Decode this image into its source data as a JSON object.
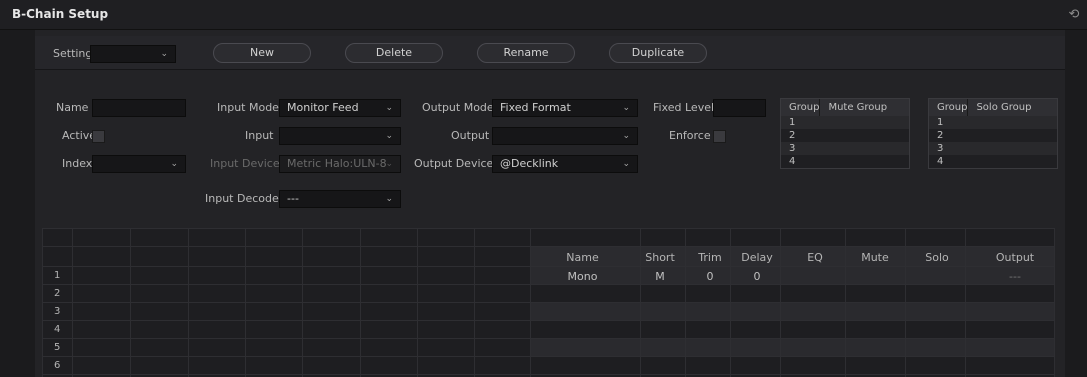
{
  "title": "B-Chain Setup",
  "toolbar": {
    "setting_label": "Setting",
    "setting_value": "",
    "buttons": [
      "New",
      "Delete",
      "Rename",
      "Duplicate"
    ]
  },
  "form": {
    "name_label": "Name",
    "active_label": "Active",
    "index_label": "Index",
    "input_mode_label": "Input Mode",
    "input_mode_value": "Monitor Feed",
    "input_label": "Input",
    "input_value": "",
    "input_device_label": "Input Device",
    "input_device_value": "Metric Halo:ULN-8",
    "input_decoder_label": "Input Decoder",
    "input_decoder_value": "---",
    "output_mode_label": "Output Mode",
    "output_mode_value": "Fixed Format",
    "output_label": "Output",
    "output_value": "",
    "output_device_label": "Output Device",
    "output_device_value": "@Decklink",
    "fixed_level_label": "Fixed Level",
    "enforce_label": "Enforce"
  },
  "mute_table": {
    "headers": [
      "Group",
      "Mute Group"
    ],
    "rows": [
      "1",
      "2",
      "3",
      "4"
    ]
  },
  "solo_table": {
    "headers": [
      "Group",
      "Solo Group"
    ],
    "rows": [
      "1",
      "2",
      "3",
      "4"
    ]
  },
  "channels": {
    "row_numbers": [
      "1",
      "2",
      "3",
      "4",
      "5",
      "6"
    ],
    "headers": [
      "Name",
      "Short",
      "Trim",
      "Delay",
      "EQ",
      "Mute",
      "Solo",
      "Output"
    ],
    "rows": [
      {
        "name": "Mono",
        "short": "M",
        "trim": "0",
        "delay": "0",
        "eq": "",
        "mute": "",
        "solo": "",
        "output": "---"
      }
    ]
  },
  "icons": {
    "reset": "reset-icon",
    "chevron": "chevron-down-icon"
  }
}
